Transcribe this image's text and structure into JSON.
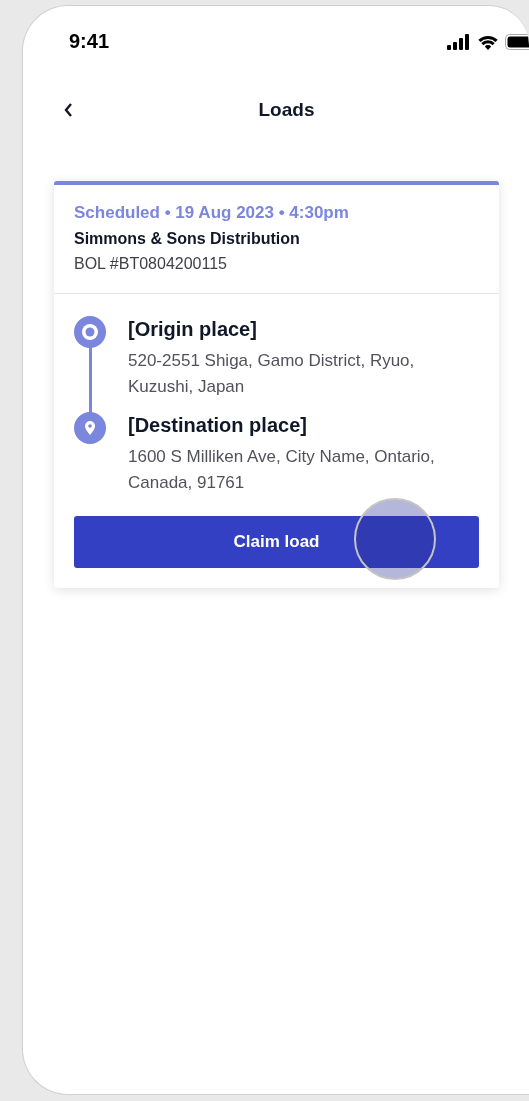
{
  "status_bar": {
    "time": "9:41"
  },
  "header": {
    "title": "Loads"
  },
  "load": {
    "status_line": "Scheduled • 19 Aug 2023 • 4:30pm",
    "company": "Simmons & Sons Distribution",
    "bol": "BOL #BT0804200115",
    "stops": [
      {
        "kind": "origin",
        "name": "[Origin place]",
        "address": "520-2551 Shiga, Gamo District, Ryuo, Kuzushi, Japan"
      },
      {
        "kind": "destination",
        "name": "[Destination place]",
        "address": "1600 S Milliken Ave, City Name, Ontario, Canada, 91761"
      }
    ],
    "action": "Claim load"
  }
}
